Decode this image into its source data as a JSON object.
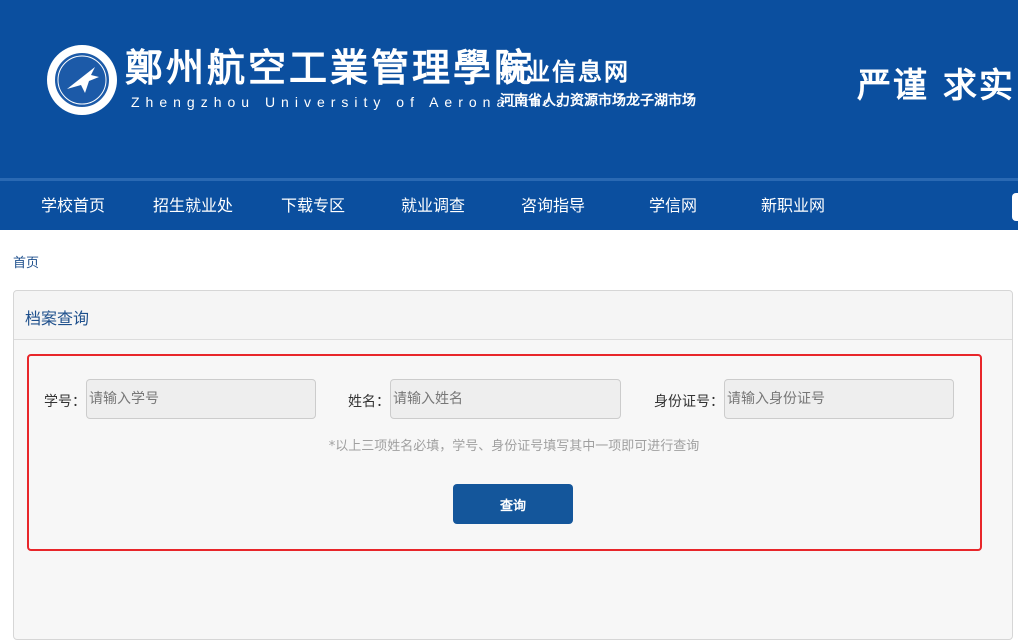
{
  "header": {
    "school_name_cn": "鄭州航空工業管理學院",
    "school_name_en": "Zhengzhou University of Aeronautics",
    "site_title": "就业信息网",
    "site_subtitle": "河南省人力资源市场龙子湖市场",
    "motto": "严谨 求实"
  },
  "nav": {
    "items": [
      {
        "label": "学校首页"
      },
      {
        "label": "招生就业处"
      },
      {
        "label": "下载专区"
      },
      {
        "label": "就业调查"
      },
      {
        "label": "咨询指导"
      },
      {
        "label": "学信网"
      },
      {
        "label": "新职业网"
      }
    ]
  },
  "breadcrumb": {
    "home": "首页"
  },
  "panel": {
    "title": "档案查询",
    "fields": {
      "student_id": {
        "label": "学号：",
        "placeholder": "请输入学号"
      },
      "name": {
        "label": "姓名：",
        "placeholder": "请输入姓名"
      },
      "id_card": {
        "label": "身份证号：",
        "placeholder": "请输入身份证号"
      }
    },
    "hint": "*以上三项姓名必填，学号、身份证号填写其中一项即可进行查询",
    "submit_label": "查询"
  },
  "colors": {
    "header_bg": "#0b4f9f",
    "button_bg": "#14569b",
    "highlight_border": "#e8262a"
  }
}
